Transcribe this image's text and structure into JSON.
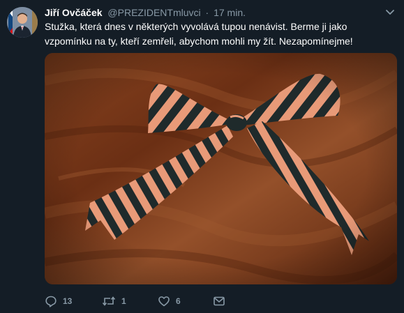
{
  "tweet": {
    "author_name": "Jiří Ovčáček",
    "handle": "@PREZIDENTmluvci",
    "separator": "·",
    "time": "17 min.",
    "text": "Stužka, která dnes v některých vyvolává tupou nenávist. Berme ji jako vzpomínku na ty, kteří zemřeli, abychom mohli my žít. Nezapomínejme!",
    "media_icon": "ribbon-bow-photo"
  },
  "actions": {
    "reply_count": "13",
    "retweet_count": "1",
    "like_count": "6"
  },
  "icons": {
    "reply": "reply-icon",
    "retweet": "retweet-icon",
    "like": "heart-icon",
    "dm": "envelope-icon",
    "caret": "chevron-down-icon"
  },
  "colors": {
    "background": "#141d26",
    "muted": "#8899a6",
    "text": "#ffffff"
  }
}
